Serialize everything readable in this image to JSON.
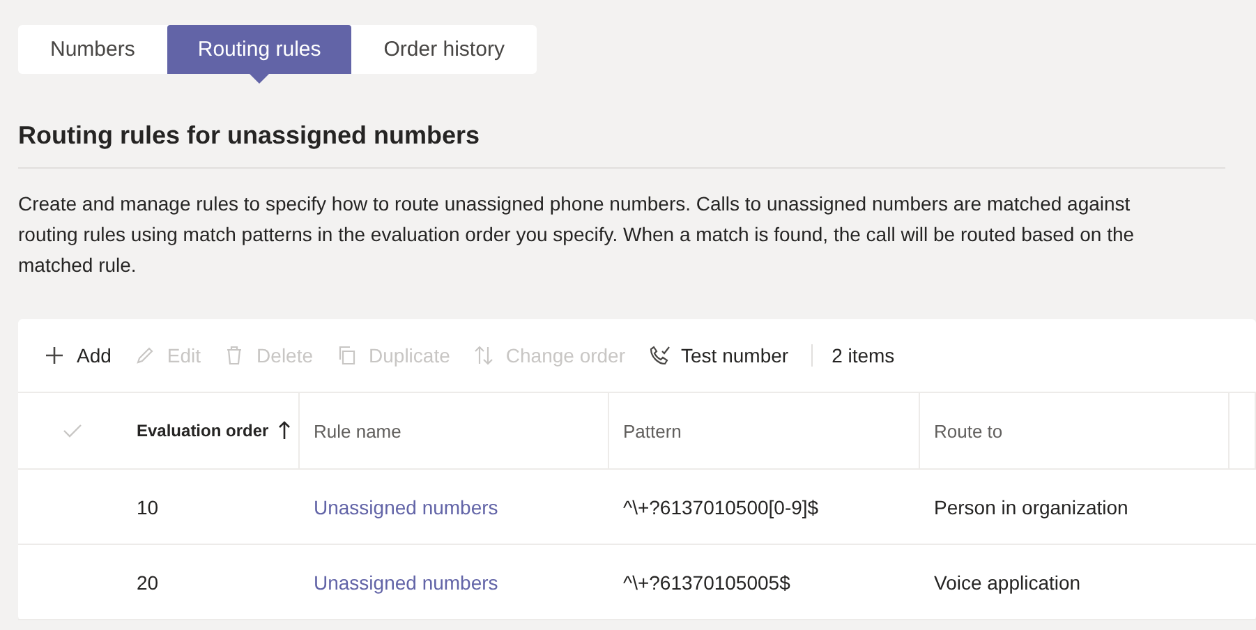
{
  "tabs": [
    {
      "label": "Numbers",
      "selected": false
    },
    {
      "label": "Routing rules",
      "selected": true
    },
    {
      "label": "Order history",
      "selected": false
    }
  ],
  "heading": "Routing rules for unassigned numbers",
  "description": "Create and manage rules to specify how to route unassigned phone numbers. Calls to unassigned numbers are matched against routing rules using match patterns in the evaluation order you specify. When a match is found, the call will be routed based on the matched rule.",
  "toolbar": {
    "actions": [
      {
        "kind": "add",
        "label": "Add",
        "disabled": false
      },
      {
        "kind": "edit",
        "label": "Edit",
        "disabled": true
      },
      {
        "kind": "delete",
        "label": "Delete",
        "disabled": true
      },
      {
        "kind": "duplicate",
        "label": "Duplicate",
        "disabled": true
      },
      {
        "kind": "reorder",
        "label": "Change order",
        "disabled": true
      },
      {
        "kind": "test",
        "label": "Test number",
        "disabled": false
      }
    ],
    "count": "2 items"
  },
  "table": {
    "columns": [
      {
        "label": "Evaluation order",
        "sorted": true
      },
      {
        "label": "Rule name",
        "sorted": false
      },
      {
        "label": "Pattern",
        "sorted": false
      },
      {
        "label": "Route to",
        "sorted": false
      }
    ],
    "rows": [
      {
        "selected": false,
        "cells": [
          "10",
          "Unassigned numbers",
          "^\\+?6137010500[0-9]$",
          "Person in organization"
        ]
      },
      {
        "selected": false,
        "cells": [
          "20",
          "Unassigned numbers",
          "^\\+?61370105005$",
          "Voice application"
        ]
      }
    ]
  }
}
